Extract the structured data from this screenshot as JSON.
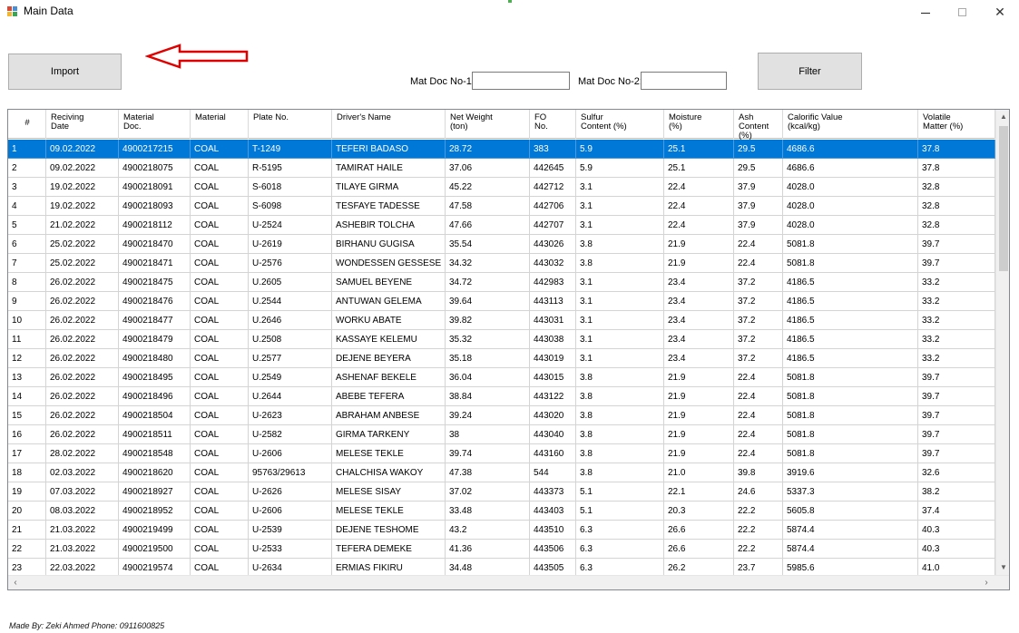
{
  "window": {
    "title": "Main Data",
    "minimize_glyph": "–",
    "close_glyph": "✕"
  },
  "toolbar": {
    "import_label": "Import",
    "filter_label": "Filter",
    "mat_doc_1_label": "Mat Doc No-1:",
    "mat_doc_1_value": "",
    "mat_doc_2_label": "Mat Doc No-2:",
    "mat_doc_2_value": ""
  },
  "grid": {
    "columns": [
      {
        "label": "#"
      },
      {
        "label": "Reciving\nDate"
      },
      {
        "label": "Material\nDoc."
      },
      {
        "label": "Material"
      },
      {
        "label": "Plate No."
      },
      {
        "label": "Driver's Name"
      },
      {
        "label": "Net Weight\n(ton)"
      },
      {
        "label": "FO\nNo."
      },
      {
        "label": "Sulfur\nContent (%)"
      },
      {
        "label": "Moisture\n(%)"
      },
      {
        "label": "Ash\nContent (%)"
      },
      {
        "label": "Calorific Value\n(kcal/kg)"
      },
      {
        "label": "Volatile\nMatter (%)"
      }
    ],
    "selected_row": 0,
    "rows": [
      [
        "1",
        "09.02.2022",
        "4900217215",
        "COAL",
        "T-1249",
        "TEFERI BADASO",
        "28.72",
        "383",
        "5.9",
        "25.1",
        "29.5",
        "4686.6",
        "37.8"
      ],
      [
        "2",
        "09.02.2022",
        "4900218075",
        "COAL",
        "R-5195",
        "TAMIRAT HAILE",
        "37.06",
        "442645",
        "5.9",
        "25.1",
        "29.5",
        "4686.6",
        "37.8"
      ],
      [
        "3",
        "19.02.2022",
        "4900218091",
        "COAL",
        "S-6018",
        "TILAYE GIRMA",
        "45.22",
        "442712",
        "3.1",
        "22.4",
        "37.9",
        "4028.0",
        "32.8"
      ],
      [
        "4",
        "19.02.2022",
        "4900218093",
        "COAL",
        "S-6098",
        "TESFAYE TADESSE",
        "47.58",
        "442706",
        "3.1",
        "22.4",
        "37.9",
        "4028.0",
        "32.8"
      ],
      [
        "5",
        "21.02.2022",
        "4900218112",
        "COAL",
        "U-2524",
        "ASHEBIR TOLCHA",
        "47.66",
        "442707",
        "3.1",
        "22.4",
        "37.9",
        "4028.0",
        "32.8"
      ],
      [
        "6",
        "25.02.2022",
        "4900218470",
        "COAL",
        "U-2619",
        "BIRHANU GUGISA",
        "35.54",
        "443026",
        "3.8",
        "21.9",
        "22.4",
        "5081.8",
        "39.7"
      ],
      [
        "7",
        "25.02.2022",
        "4900218471",
        "COAL",
        "U-2576",
        "WONDESSEN GESSESE",
        "34.32",
        "443032",
        "3.8",
        "21.9",
        "22.4",
        "5081.8",
        "39.7"
      ],
      [
        "8",
        "26.02.2022",
        "4900218475",
        "COAL",
        "U.2605",
        "SAMUEL BEYENE",
        "34.72",
        "442983",
        "3.1",
        "23.4",
        "37.2",
        "4186.5",
        "33.2"
      ],
      [
        "9",
        "26.02.2022",
        "4900218476",
        "COAL",
        "U.2544",
        "ANTUWAN GELEMA",
        "39.64",
        "443113",
        "3.1",
        "23.4",
        "37.2",
        "4186.5",
        "33.2"
      ],
      [
        "10",
        "26.02.2022",
        "4900218477",
        "COAL",
        "U.2646",
        "WORKU ABATE",
        "39.82",
        "443031",
        "3.1",
        "23.4",
        "37.2",
        "4186.5",
        "33.2"
      ],
      [
        "11",
        "26.02.2022",
        "4900218479",
        "COAL",
        "U.2508",
        "KASSAYE KELEMU",
        "35.32",
        "443038",
        "3.1",
        "23.4",
        "37.2",
        "4186.5",
        "33.2"
      ],
      [
        "12",
        "26.02.2022",
        "4900218480",
        "COAL",
        "U.2577",
        "DEJENE BEYERA",
        "35.18",
        "443019",
        "3.1",
        "23.4",
        "37.2",
        "4186.5",
        "33.2"
      ],
      [
        "13",
        "26.02.2022",
        "4900218495",
        "COAL",
        "U.2549",
        "ASHENAF BEKELE",
        "36.04",
        "443015",
        "3.8",
        "21.9",
        "22.4",
        "5081.8",
        "39.7"
      ],
      [
        "14",
        "26.02.2022",
        "4900218496",
        "COAL",
        "U.2644",
        "ABEBE TEFERA",
        "38.84",
        "443122",
        "3.8",
        "21.9",
        "22.4",
        "5081.8",
        "39.7"
      ],
      [
        "15",
        "26.02.2022",
        "4900218504",
        "COAL",
        "U-2623",
        "ABRAHAM ANBESE",
        "39.24",
        "443020",
        "3.8",
        "21.9",
        "22.4",
        "5081.8",
        "39.7"
      ],
      [
        "16",
        "26.02.2022",
        "4900218511",
        "COAL",
        "U-2582",
        "GIRMA TARKENY",
        "38",
        "443040",
        "3.8",
        "21.9",
        "22.4",
        "5081.8",
        "39.7"
      ],
      [
        "17",
        "28.02.2022",
        "4900218548",
        "COAL",
        "U-2606",
        "MELESE TEKLE",
        "39.74",
        "443160",
        "3.8",
        "21.9",
        "22.4",
        "5081.8",
        "39.7"
      ],
      [
        "18",
        "02.03.2022",
        "4900218620",
        "COAL",
        "95763/29613",
        "CHALCHISA WAKOY",
        "47.38",
        "544",
        "3.8",
        "21.0",
        "39.8",
        "3919.6",
        "32.6"
      ],
      [
        "19",
        "07.03.2022",
        "4900218927",
        "COAL",
        "U-2626",
        "MELESE SISAY",
        "37.02",
        "443373",
        "5.1",
        "22.1",
        "24.6",
        "5337.3",
        "38.2"
      ],
      [
        "20",
        "08.03.2022",
        "4900218952",
        "COAL",
        "U-2606",
        "MELESE TEKLE",
        "33.48",
        "443403",
        "5.1",
        "20.3",
        "22.2",
        "5605.8",
        "37.4"
      ],
      [
        "21",
        "21.03.2022",
        "4900219499",
        "COAL",
        "U-2539",
        "DEJENE TESHOME",
        "43.2",
        "443510",
        "6.3",
        "26.6",
        "22.2",
        "5874.4",
        "40.3"
      ],
      [
        "22",
        "21.03.2022",
        "4900219500",
        "COAL",
        "U-2533",
        "TEFERA DEMEKE",
        "41.36",
        "443506",
        "6.3",
        "26.6",
        "22.2",
        "5874.4",
        "40.3"
      ],
      [
        "23",
        "22.03.2022",
        "4900219574",
        "COAL",
        "U-2634",
        "ERMIAS FIKIRU",
        "34.48",
        "443505",
        "6.3",
        "26.2",
        "23.7",
        "5985.6",
        "41.0"
      ]
    ]
  },
  "icons": {
    "app_icon": "window-app-icon",
    "annotation": "red-arrow-icon"
  },
  "colors": {
    "selection": "#0078d7",
    "arrow": "#e00000"
  },
  "footer": {
    "text": "Made By: Zeki Ahmed   Phone: 0911600825"
  }
}
